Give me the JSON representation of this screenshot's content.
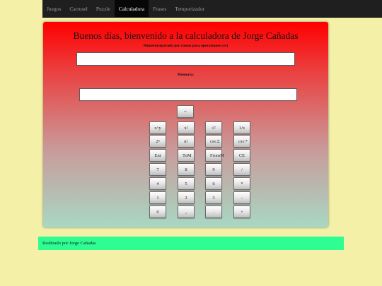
{
  "nav": {
    "items": [
      {
        "label": "Juegos"
      },
      {
        "label": "Carrusel"
      },
      {
        "label": "Puzzle"
      },
      {
        "label": "Calculadora",
        "active": true
      },
      {
        "label": "Frases"
      },
      {
        "label": "Temporizador"
      }
    ]
  },
  "calculator": {
    "title": "Buenos días, bienvenido a la calculadora de Jorge Cañadas",
    "number_label": "Número(separado por comas para operaciones csv)",
    "number_value": "",
    "memory_label": "Memoria:",
    "memory_value": "",
    "equals_label": "=",
    "rows": [
      [
        "x^y",
        "x²",
        "√²",
        "1/x"
      ],
      [
        "2ⁿ",
        "n!",
        "csv.Σ",
        "csv.*"
      ],
      [
        "Ent",
        "ToM",
        "FromM",
        "CE"
      ],
      [
        "7",
        "8",
        "9",
        "/"
      ],
      [
        "4",
        "5",
        "6",
        "*"
      ],
      [
        "1",
        "2",
        "3",
        "-"
      ],
      [
        "0",
        ",",
        ".",
        "+"
      ]
    ]
  },
  "footer": {
    "text": "Realizado por Jorge Cañadas"
  },
  "colors": {
    "page_bg": "#f4f0a8",
    "nav_bg": "#1f1f1f",
    "gradient_top": "#ff0000",
    "gradient_bottom": "#a8d8c4",
    "footer_bg": "#2efd92"
  }
}
